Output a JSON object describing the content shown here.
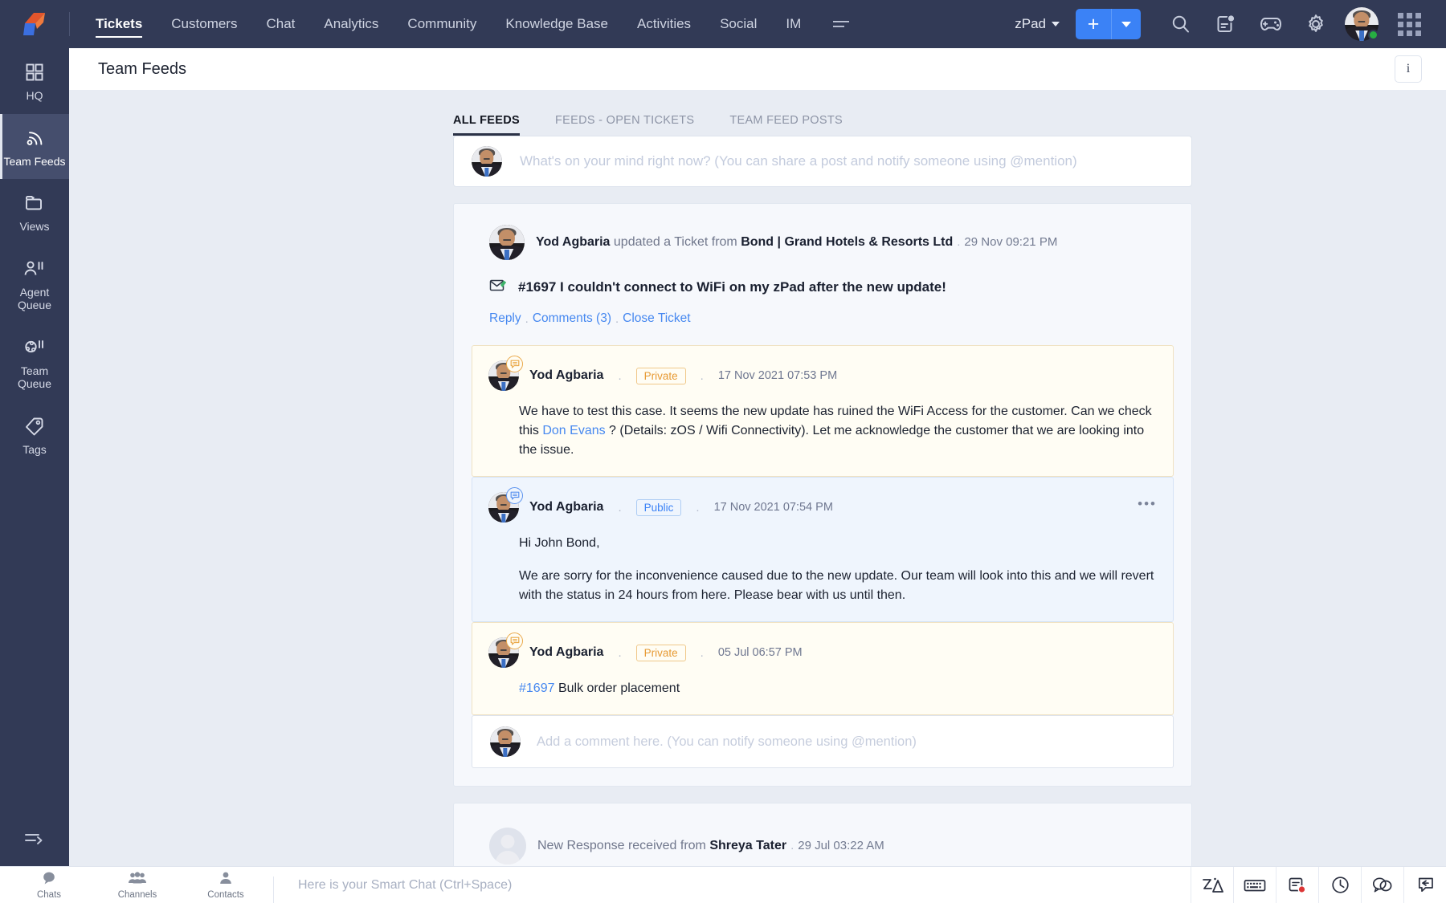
{
  "topbar": {
    "logo_name": "brand-logo",
    "nav": [
      {
        "label": "Tickets",
        "active": true
      },
      {
        "label": "Customers",
        "active": false
      },
      {
        "label": "Chat",
        "active": false
      },
      {
        "label": "Analytics",
        "active": false
      },
      {
        "label": "Community",
        "active": false
      },
      {
        "label": "Knowledge Base",
        "active": false
      },
      {
        "label": "Activities",
        "active": false
      },
      {
        "label": "Social",
        "active": false
      },
      {
        "label": "IM",
        "active": false
      }
    ],
    "more_icon": "hamburger-more-icon",
    "org": "zPad",
    "add_label": "+",
    "icons": [
      "search-icon",
      "notes-notification-icon",
      "gamification-icon",
      "settings-gear-icon"
    ],
    "avatar": "user-avatar",
    "apps_icon": "apps-grid-icon"
  },
  "sidebar": {
    "items": [
      {
        "label": "HQ",
        "icon": "hq-grid-icon",
        "active": false
      },
      {
        "label": "Team Feeds",
        "icon": "feed-signal-icon",
        "active": true
      },
      {
        "label": "Views",
        "icon": "views-folder-icon",
        "active": false
      },
      {
        "label": "Agent Queue",
        "icon": "agent-queue-icon",
        "active": false
      },
      {
        "label": "Team Queue",
        "icon": "team-queue-icon",
        "active": false
      },
      {
        "label": "Tags",
        "icon": "tag-icon",
        "active": false
      }
    ],
    "collapse_icon": "collapse-sidebar-icon"
  },
  "page": {
    "title": "Team Feeds",
    "info_button": "i"
  },
  "tabs": [
    {
      "label": "ALL FEEDS",
      "active": true
    },
    {
      "label": "FEEDS - OPEN TICKETS",
      "active": false
    },
    {
      "label": "TEAM FEED POSTS",
      "active": false
    }
  ],
  "composer": {
    "placeholder": "What's on your mind right now? (You can share a post and notify someone using @mention)"
  },
  "post": {
    "author": "Yod Agbaria",
    "action_text": " updated a Ticket from ",
    "customer": "Bond | Grand Hotels & Resorts Ltd",
    "time": "29 Nov 09:21 PM",
    "subject_id": "#1697",
    "subject": "I couldn't connect to WiFi on my zPad after the new update!",
    "subject_full": "#1697 I couldn't connect to WiFi on my zPad after the new update!",
    "subject_icon": "email-ticket-icon",
    "actions": [
      {
        "label": "Reply"
      },
      {
        "label": "Comments (3)"
      },
      {
        "label": "Close Ticket"
      }
    ],
    "comments": [
      {
        "author": "Yod Agbaria",
        "visibility": "Private",
        "type": "private",
        "time": "17 Nov 2021 07:53 PM",
        "paragraphs": [
          {
            "pre": "We have to test this case. It seems the new update has ruined the WiFi Access for the customer. Can we check this ",
            "mention": "Don Evans",
            "post": " ? (Details: zOS / Wifi Connectivity). Let me acknowledge the customer that we are looking into the issue."
          }
        ],
        "has_more_menu": false
      },
      {
        "author": "Yod Agbaria",
        "visibility": "Public",
        "type": "public",
        "time": "17 Nov 2021 07:54 PM",
        "paragraphs": [
          {
            "pre": "Hi John Bond,",
            "mention": "",
            "post": ""
          },
          {
            "pre": "We are sorry for the inconvenience caused due to the new update. Our team will look into this and we will revert with the status in 24 hours from here. Please bear with us until then.",
            "mention": "",
            "post": ""
          }
        ],
        "has_more_menu": true,
        "more_menu": "•••"
      },
      {
        "author": "Yod Agbaria",
        "visibility": "Private",
        "type": "private",
        "time": "05 Jul 06:57 PM",
        "ticket_link": "#1697",
        "ticket_text": " Bulk order placement",
        "paragraphs": [],
        "has_more_menu": false
      }
    ],
    "comment_box_placeholder": "Add a comment here. (You can notify someone using @mention)"
  },
  "post2": {
    "prefix": "New Response received from ",
    "author": "Shreya Tater",
    "time": "29 Jul 03:22 AM"
  },
  "bottombar": {
    "tabs": [
      {
        "label": "Chats",
        "icon": "chat-bubble-icon"
      },
      {
        "label": "Channels",
        "icon": "channels-group-icon"
      },
      {
        "label": "Contacts",
        "icon": "contact-person-icon"
      }
    ],
    "search_placeholder": "Here is your Smart Chat (Ctrl+Space)",
    "right_icons": [
      "zia-assistant-icon",
      "keyboard-icon",
      "notes-alert-icon",
      "clock-history-icon",
      "chat-conversation-icon",
      "reply-arrow-icon"
    ]
  },
  "colors": {
    "topbar_bg": "#323a56",
    "accent_blue": "#3b82f6",
    "private_amber": "#e79a33",
    "page_bg": "#e8ecf3"
  }
}
